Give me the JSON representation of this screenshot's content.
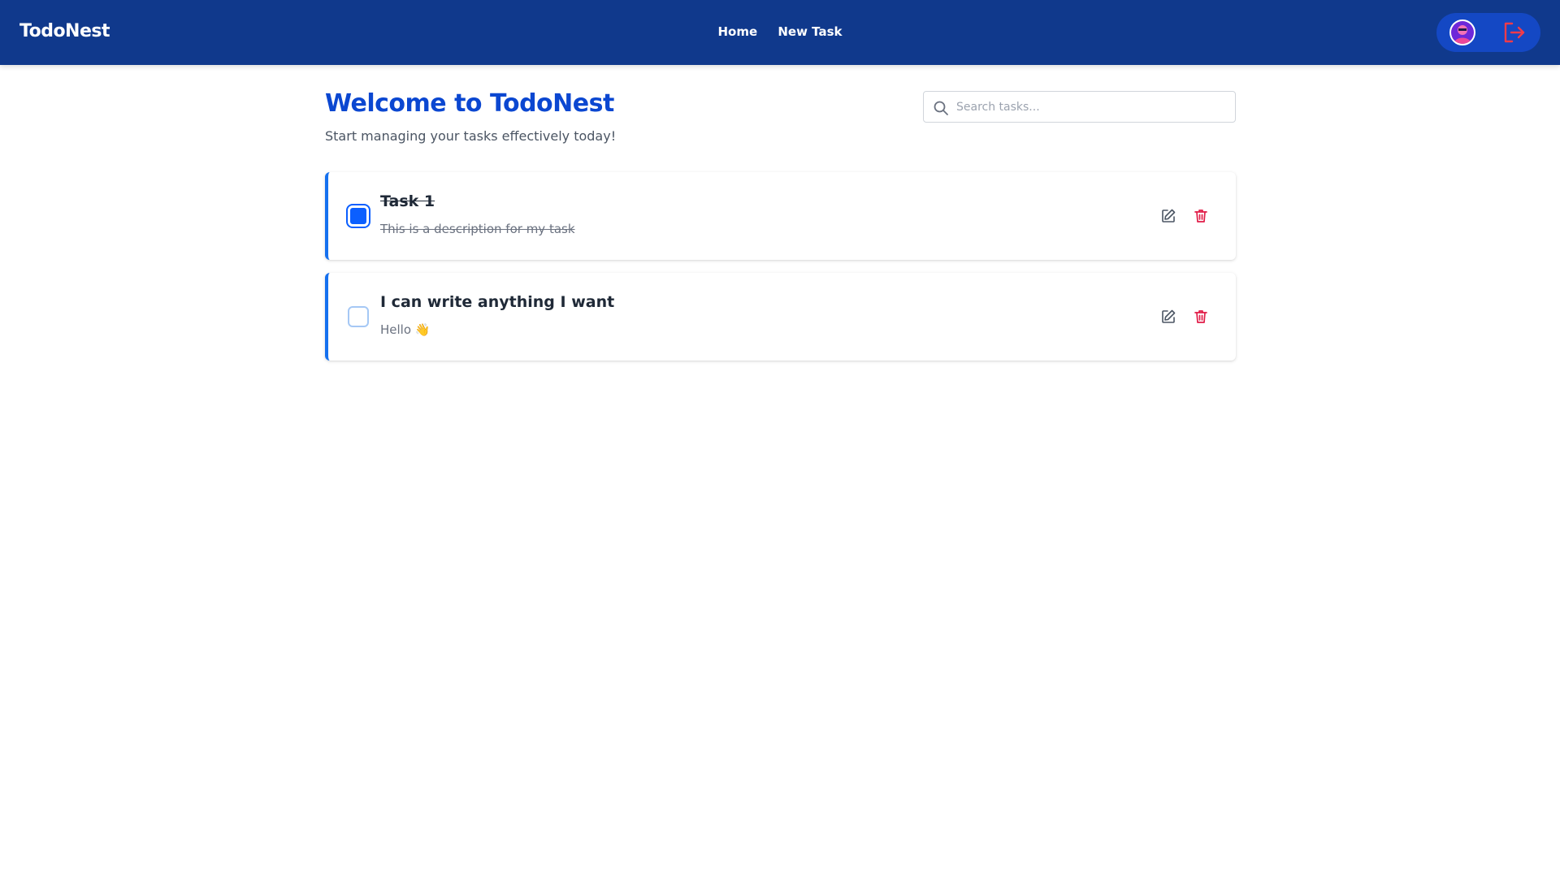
{
  "app": {
    "brand": "TodoNest"
  },
  "nav": {
    "items": [
      {
        "label": "Home"
      },
      {
        "label": "New Task"
      }
    ]
  },
  "user": {
    "avatar_icon": "user-avatar-icon",
    "logout_icon": "logout-icon"
  },
  "main": {
    "title": "Welcome to TodoNest",
    "subtitle": "Start managing your tasks effectively today!",
    "search": {
      "placeholder": "Search tasks...",
      "value": ""
    }
  },
  "tasks": [
    {
      "title": "Task 1",
      "description": "This is a description for my task",
      "completed": true
    },
    {
      "title": "I can write anything I want",
      "description": "Hello 👋",
      "completed": false
    }
  ],
  "colors": {
    "header": "#10398c",
    "accent": "#0b47d1",
    "checkbox": "#0b5fff",
    "delete": "#e11d48"
  }
}
